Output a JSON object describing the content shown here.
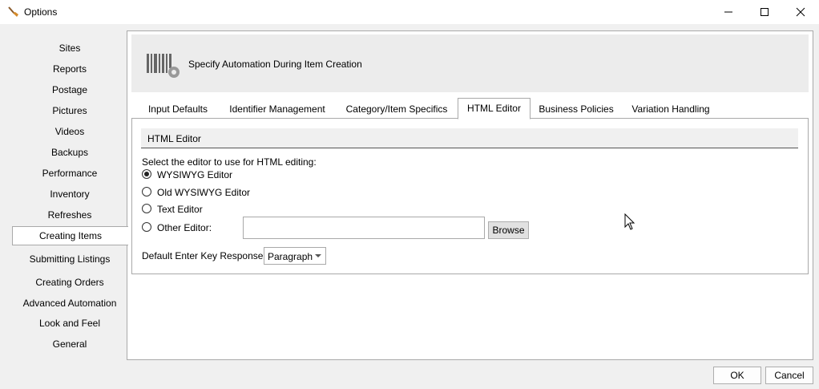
{
  "window": {
    "title": "Options",
    "app_icon": "broom-icon",
    "minimize_icon": "minimize-icon",
    "maximize_icon": "maximize-icon",
    "close_icon": "close-icon"
  },
  "sidebar": {
    "active": "Creating Items",
    "items": [
      {
        "label": "Sites"
      },
      {
        "label": "Reports"
      },
      {
        "label": "Postage"
      },
      {
        "label": "Pictures"
      },
      {
        "label": "Videos"
      },
      {
        "label": "Backups"
      },
      {
        "label": "Performance"
      },
      {
        "label": "Inventory"
      },
      {
        "label": "Refreshes"
      },
      {
        "label": "Creating Items"
      },
      {
        "label": "Submitting Listings"
      },
      {
        "label": "Creating Orders"
      },
      {
        "label": "Advanced Automation"
      },
      {
        "label": "Look and Feel"
      },
      {
        "label": "General"
      }
    ]
  },
  "header": {
    "icon": "barcode-gear-icon",
    "text": "Specify Automation During Item Creation"
  },
  "tabs": {
    "active": "HTML Editor",
    "items": [
      {
        "label": "Input Defaults"
      },
      {
        "label": "Identifier Management"
      },
      {
        "label": "Category/Item Specifics"
      },
      {
        "label": "HTML Editor"
      },
      {
        "label": "Business Policies"
      },
      {
        "label": "Variation Handling"
      }
    ]
  },
  "html_editor": {
    "group_title": "HTML Editor",
    "prompt": "Select the editor to use for HTML editing:",
    "options": [
      {
        "label": "WYSIWYG Editor",
        "checked": true
      },
      {
        "label": "Old WYSIWYG Editor",
        "checked": false
      },
      {
        "label": "Text Editor",
        "checked": false
      },
      {
        "label": "Other Editor:",
        "checked": false
      }
    ],
    "other_editor_value": "",
    "browse_label": "Browse",
    "enter_key_label": "Default Enter Key Response:",
    "enter_key_value": "Paragraph"
  },
  "footer": {
    "ok_label": "OK",
    "cancel_label": "Cancel"
  }
}
